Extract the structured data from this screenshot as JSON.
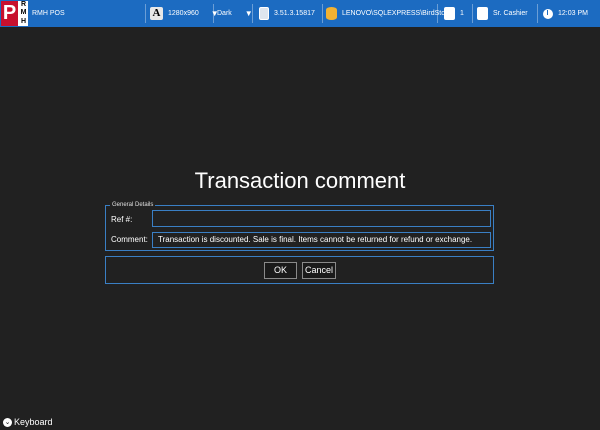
{
  "app": {
    "logo_letter": "P",
    "logo_small": [
      "R",
      "M",
      "H"
    ],
    "name": "RMH POS"
  },
  "topbar": {
    "resolution": "1280x960",
    "theme": "Dark",
    "version": "3.51.3.15817",
    "database": "LENOVO\\SQLEXPRESS\\BirdStore",
    "users_count": "1",
    "cashier": "Sr. Cashier",
    "time": "12:03 PM",
    "icons": [
      "font-icon",
      "version-icon",
      "database-icon",
      "users-icon",
      "cashier-icon",
      "clock-icon"
    ]
  },
  "dialog": {
    "title": "Transaction comment",
    "group_label": "General Details",
    "ref_label": "Ref #:",
    "ref_value": "",
    "comment_label": "Comment:",
    "comment_value": "Transaction is discounted. Sale is final. Items cannot be returned for refund or exchange.",
    "ok_label": "OK",
    "cancel_label": "Cancel"
  },
  "footer": {
    "keyboard_label": "Keyboard"
  },
  "colors": {
    "background": "#212121",
    "topbar": "#1c6bc1",
    "accent_border": "#3a7fc4",
    "logo_red": "#c8102e"
  }
}
